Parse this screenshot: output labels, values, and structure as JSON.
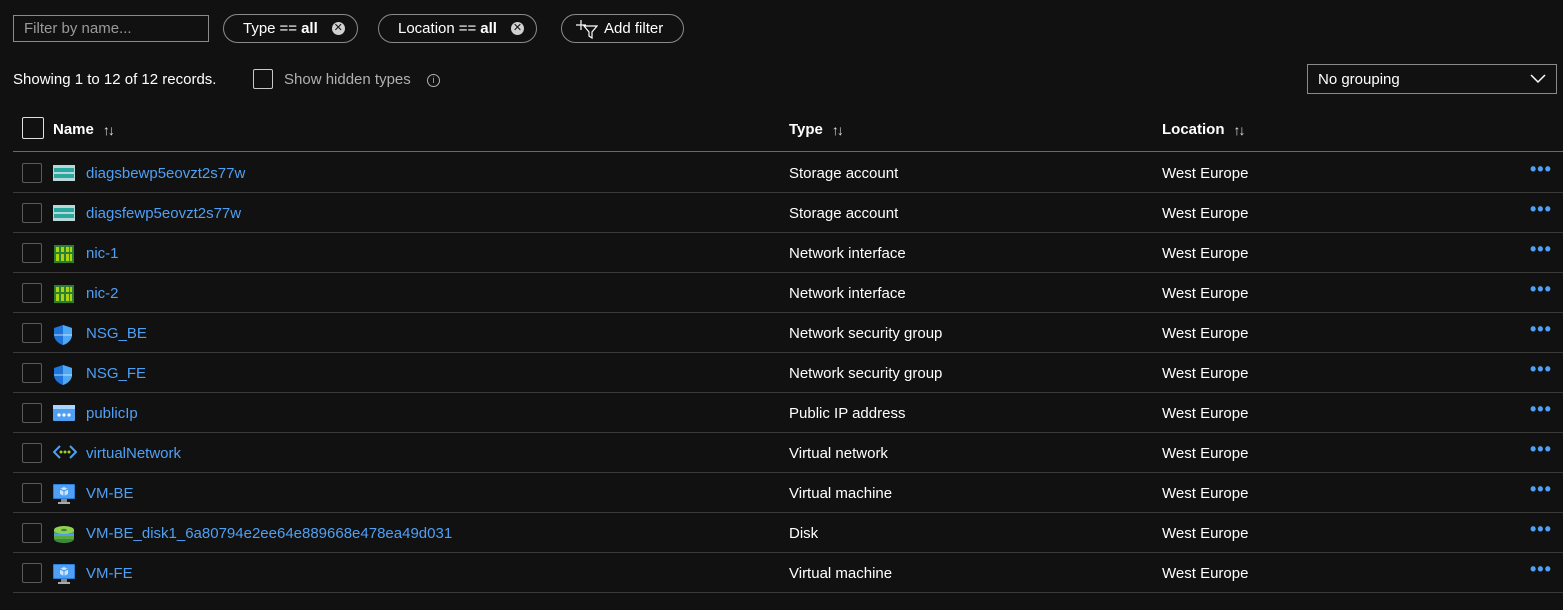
{
  "toolbar": {
    "filter_placeholder": "Filter by name...",
    "type_filter": {
      "field": "Type",
      "op": "==",
      "value": "all"
    },
    "location_filter": {
      "field": "Location",
      "op": "==",
      "value": "all"
    },
    "add_filter_label": "Add filter",
    "clear_icon": "✕"
  },
  "summary": {
    "records_text": "Showing 1 to 12 of 12 records.",
    "show_hidden_label": "Show hidden types",
    "info_icon": "i"
  },
  "grouping": {
    "selected": "No grouping"
  },
  "columns": {
    "name": "Name",
    "type": "Type",
    "location": "Location",
    "sort_icon": "↑↓"
  },
  "rows": [
    {
      "name": "diagsbewp5eovzt2s77w",
      "type": "Storage account",
      "location": "West Europe",
      "icon": "storage-account-icon"
    },
    {
      "name": "diagsfewp5eovzt2s77w",
      "type": "Storage account",
      "location": "West Europe",
      "icon": "storage-account-icon"
    },
    {
      "name": "nic-1",
      "type": "Network interface",
      "location": "West Europe",
      "icon": "network-interface-icon"
    },
    {
      "name": "nic-2",
      "type": "Network interface",
      "location": "West Europe",
      "icon": "network-interface-icon"
    },
    {
      "name": "NSG_BE",
      "type": "Network security group",
      "location": "West Europe",
      "icon": "shield-icon"
    },
    {
      "name": "NSG_FE",
      "type": "Network security group",
      "location": "West Europe",
      "icon": "shield-icon"
    },
    {
      "name": "publicIp",
      "type": "Public IP address",
      "location": "West Europe",
      "icon": "public-ip-icon"
    },
    {
      "name": "virtualNetwork",
      "type": "Virtual network",
      "location": "West Europe",
      "icon": "virtual-network-icon"
    },
    {
      "name": "VM-BE",
      "type": "Virtual machine",
      "location": "West Europe",
      "icon": "virtual-machine-icon"
    },
    {
      "name": "VM-BE_disk1_6a80794e2ee64e889668e478ea49d031",
      "type": "Disk",
      "location": "West Europe",
      "icon": "disk-icon"
    },
    {
      "name": "VM-FE",
      "type": "Virtual machine",
      "location": "West Europe",
      "icon": "virtual-machine-icon"
    }
  ],
  "more_icon": "•••",
  "colors": {
    "background": "#111111",
    "link": "#4fa0f5",
    "accent": "#0078d4"
  }
}
